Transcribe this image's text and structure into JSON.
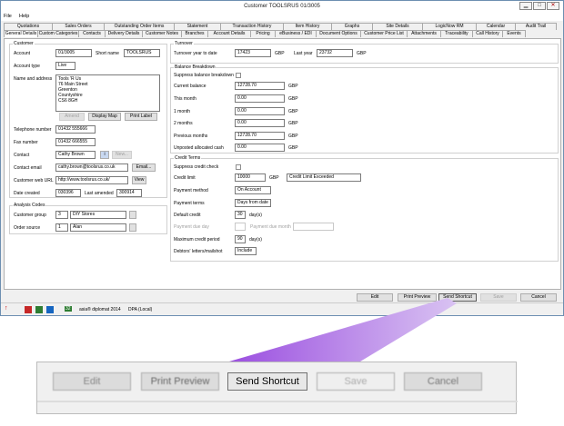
{
  "window": {
    "title": "Customer TOOLSRUS 01/3005",
    "min": "▁",
    "max": "□",
    "close": "✕"
  },
  "menu": {
    "file": "File",
    "help": "Help"
  },
  "tabs_top": [
    "Quotations",
    "Sales Orders",
    "Outstanding Order Items",
    "Statement",
    "Transaction History",
    "Item History",
    "Graphs",
    "Site Details",
    "LogicNow RM",
    "Calendar",
    "Audit Trail"
  ],
  "tabs_bottom": [
    "General Details",
    "Custom Categories",
    "Contacts",
    "Delivery Details",
    "Customer Notes",
    "Branches",
    "Account Details",
    "Pricing",
    "eBusiness / EDI",
    "Document Options",
    "Customer Price List",
    "Attachments",
    "Traceability",
    "Call History",
    "Events"
  ],
  "customer": {
    "group_label": "Customer",
    "account_label": "Account",
    "account": "01/3005",
    "short_name_label": "Short name",
    "short_name": "TOOLSRUS",
    "account_type_label": "Account type",
    "account_type": "Live",
    "name_address_label": "Name and address",
    "address_lines": [
      "Tools 'R Us",
      "76 Main Street",
      "Greenton",
      "Countyshire",
      "CS6 8GH"
    ],
    "amend": "Amend",
    "display_map": "Display Map",
    "print_label": "Print Label",
    "telephone_label": "Telephone number",
    "telephone": "01432 555666",
    "fax_label": "Fax number",
    "fax": "01432 666555",
    "contact_label": "Contact",
    "contact": "Cathy Brown",
    "new_btn": "New...",
    "email_label": "Contact email",
    "email": "cathy.brown@toolsrus.co.uk",
    "email_btn": "Email...",
    "web_label": "Customer web URL",
    "web": "http://www.toolsrus.co.uk/",
    "view_btn": "View",
    "date_created_label": "Date created",
    "date_created": "030396",
    "last_amended_label": "Last amended",
    "last_amended": "300914"
  },
  "analysis": {
    "group_label": "Analysis Codes",
    "group_code_label": "Customer group",
    "group_code": "3",
    "group_name": "DIY Stores",
    "source_label": "Order source",
    "source_code": "1",
    "source_name": "Alan"
  },
  "turnover": {
    "group_label": "Turnover",
    "ytd_label": "Turnover year to date",
    "ytd": "17423",
    "ytd_cur": "GBP",
    "last_year_label": "Last year",
    "last_year": "23732",
    "last_year_cur": "GBP"
  },
  "balance": {
    "group_label": "Balance Breakdown",
    "suppress_label": "Suppress balance breakdown",
    "rows": [
      {
        "label": "Current balance",
        "value": "12728.70",
        "cur": "GBP"
      },
      {
        "label": "This month",
        "value": "0.00",
        "cur": "GBP"
      },
      {
        "label": "1 month",
        "value": "0.00",
        "cur": "GBP"
      },
      {
        "label": "2 months",
        "value": "0.00",
        "cur": "GBP"
      },
      {
        "label": "Previous months",
        "value": "12728.70",
        "cur": "GBP"
      },
      {
        "label": "Unposted allocated cash",
        "value": "0.00",
        "cur": "GBP"
      }
    ]
  },
  "credit": {
    "group_label": "Credit Terms",
    "suppress_label": "Suppress credit check",
    "limit_label": "Credit limit",
    "limit": "10000",
    "limit_cur": "GBP",
    "limit_status": "Credit Limit Exceeded",
    "payment_method_label": "Payment method",
    "payment_method": "On Account",
    "payment_terms_label": "Payment terms",
    "payment_terms": "Days from date",
    "default_credit_label": "Default credit",
    "default_credit": "30",
    "days_unit": "day(s)",
    "due_day_label": "Payment due day",
    "due_month_label": "Payment due month",
    "max_period_label": "Maximum credit period",
    "max_period": "90",
    "max_unit": "day(s)",
    "letters_label": "Debtors' letters/mailshot",
    "letters": "Include"
  },
  "actions": {
    "edit": "Edit",
    "print_preview": "Print Preview",
    "send_shortcut": "Send Shortcut",
    "save": "Save",
    "cancel": "Cancel"
  },
  "statusbar": {
    "badge": "32",
    "app": "asia® diplomat 2014",
    "db": "DPA (Local)"
  },
  "accent": "#9b4fe0"
}
